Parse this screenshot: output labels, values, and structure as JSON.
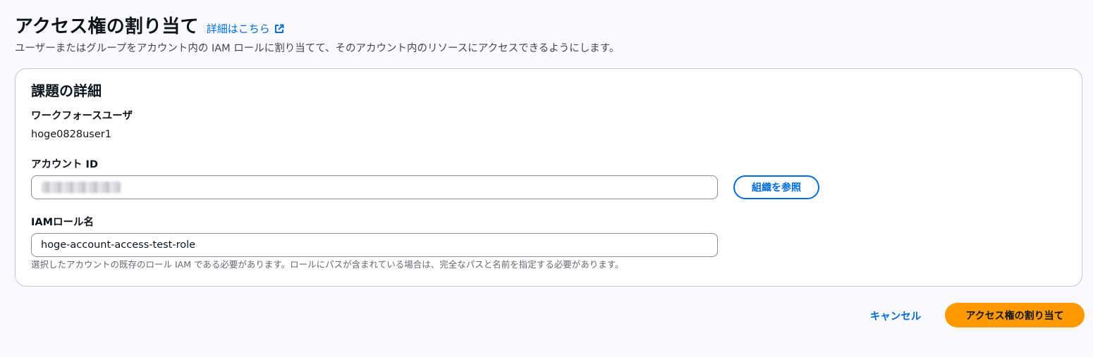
{
  "header": {
    "title": "アクセス権の割り当て",
    "info_link": "詳細はこちら",
    "info_link_icon": "external-link-icon",
    "description": "ユーザーまたはグループをアカウント内の IAM ロールに割り当てて、そのアカウント内のリソースにアクセスできるようにします。"
  },
  "card": {
    "title": "課題の詳細",
    "workforce_user": {
      "label": "ワークフォースユーザ",
      "value": "hoge0828user1"
    },
    "account_id": {
      "label": "アカウント ID",
      "value": "",
      "browse_label": "組織を参照"
    },
    "role_name": {
      "label": "IAMロール名",
      "value": "hoge-account-access-test-role",
      "hint": "選択したアカウントの既存のロール IAM である必要があります。ロールにパスが含まれている場合は、完全なパスと名前を指定する必要があります。"
    }
  },
  "actions": {
    "cancel_label": "キャンセル",
    "submit_label": "アクセス権の割り当て"
  },
  "colors": {
    "link": "#006ce0",
    "primary_button": "#ff9900",
    "background": "#fafafd"
  }
}
